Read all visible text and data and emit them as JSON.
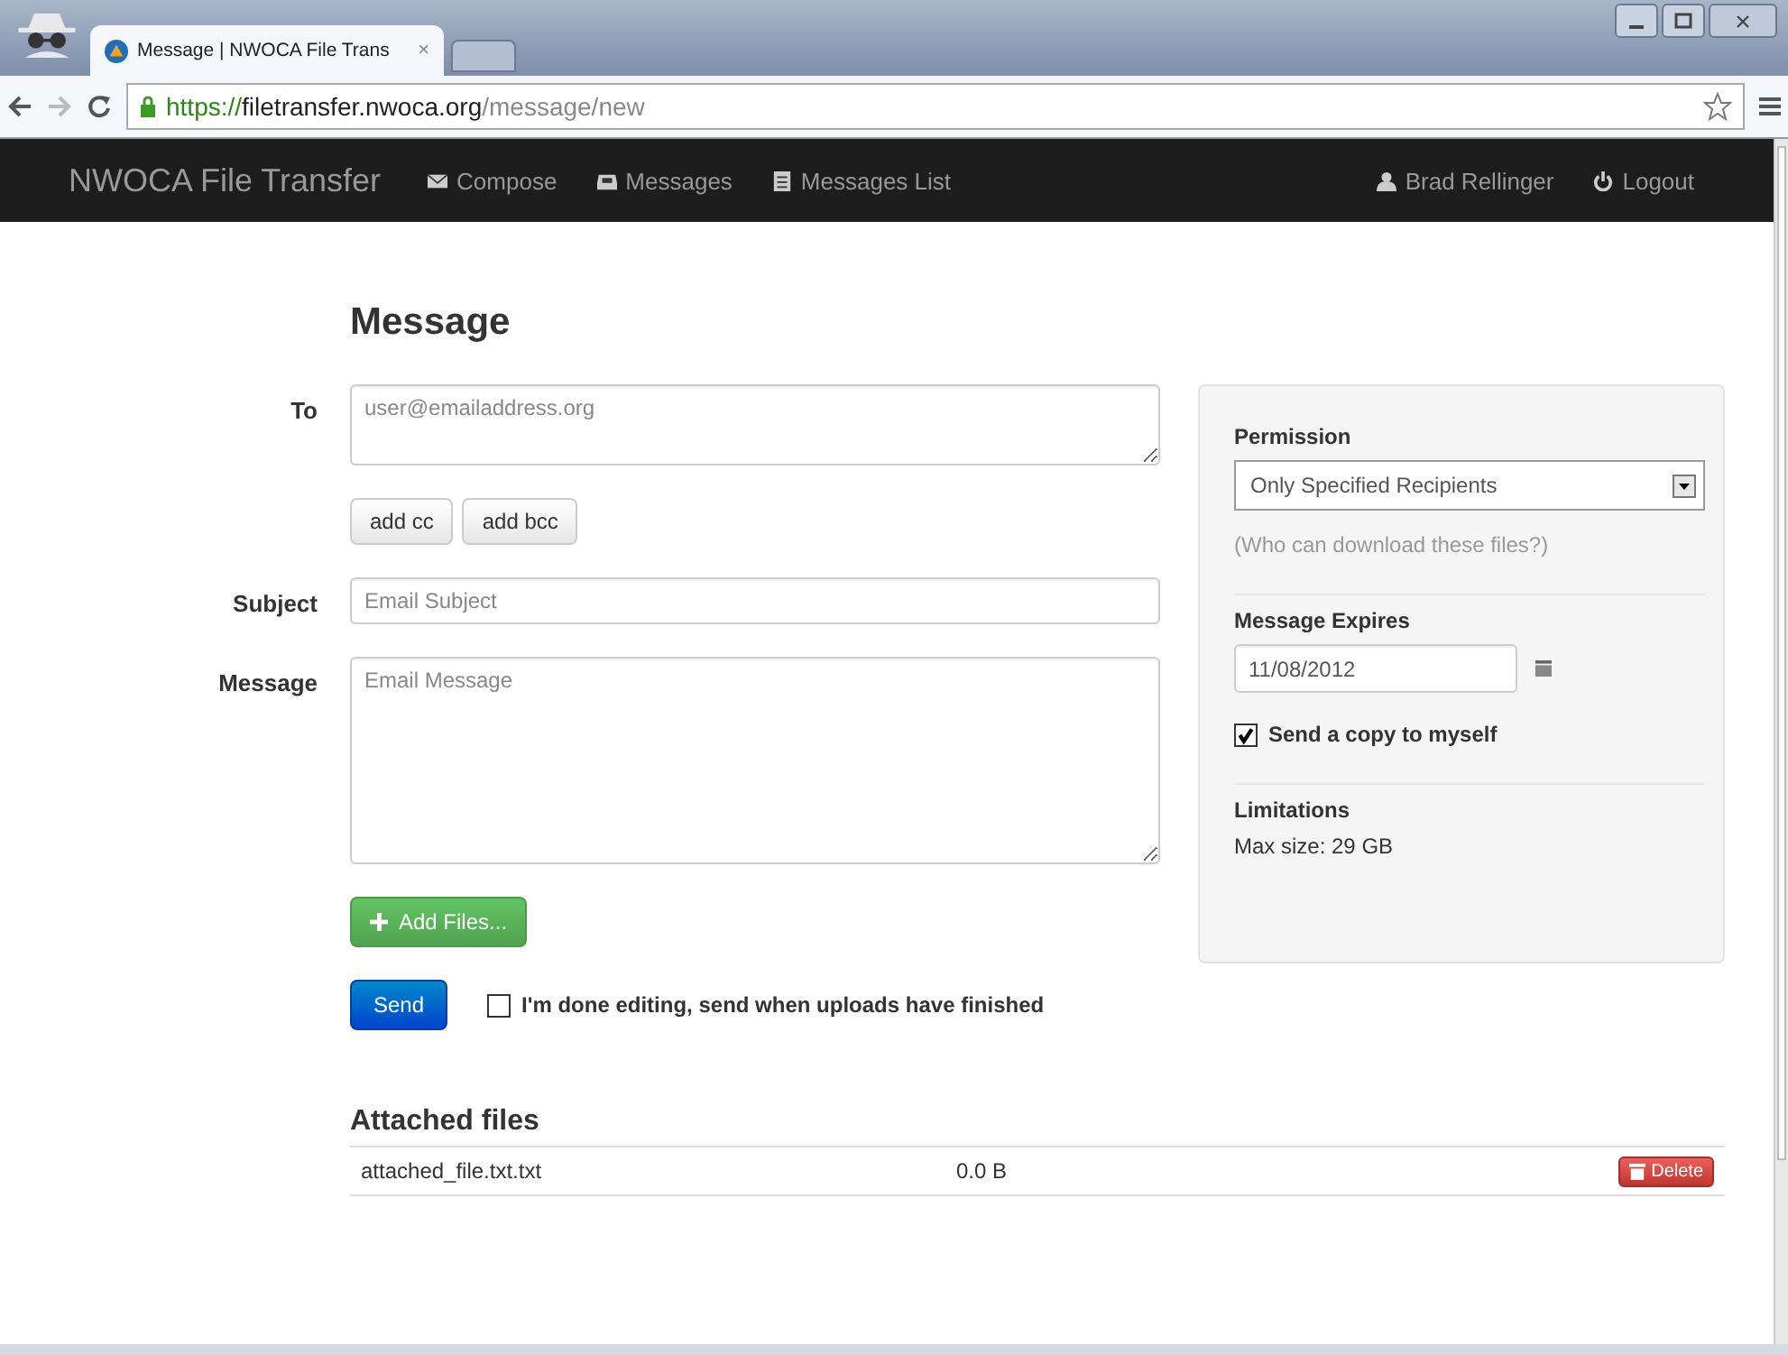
{
  "browser": {
    "tab_title": "Message | NWOCA File Trans",
    "tab_close": "×",
    "url": {
      "scheme": "https://",
      "host": "filetransfer.nwoca.org",
      "path": "/message/new"
    }
  },
  "navbar": {
    "brand": "NWOCA File Transfer",
    "items": [
      {
        "label": "Compose"
      },
      {
        "label": "Messages"
      },
      {
        "label": "Messages List"
      }
    ],
    "right_items": [
      {
        "label": "Brad Rellinger"
      },
      {
        "label": "Logout"
      }
    ]
  },
  "form": {
    "heading": "Message",
    "to": {
      "label": "To",
      "placeholder": "user@emailaddress.org"
    },
    "cc_buttons": [
      "add cc",
      "add bcc"
    ],
    "subject": {
      "label": "Subject",
      "placeholder": "Email Subject"
    },
    "message": {
      "label": "Message",
      "placeholder": "Email Message"
    },
    "add_files": "Add Files...",
    "send": "Send",
    "done_editing": {
      "label": "I'm done editing, send when uploads have finished",
      "checked": false
    }
  },
  "sidebar": {
    "permission": {
      "label": "Permission",
      "value": "Only Specified Recipients",
      "help": "(Who can download these files?)"
    },
    "expires": {
      "label": "Message Expires",
      "value": "11/08/2012"
    },
    "send_copy": {
      "label": "Send a copy to myself",
      "checked": true
    },
    "limitations": {
      "label": "Limitations",
      "text": "Max size: 29 GB"
    }
  },
  "attached": {
    "heading": "Attached files",
    "delete_label": "Delete",
    "files": [
      {
        "name": "attached_file.txt.txt",
        "size": "0.0 B"
      }
    ]
  }
}
